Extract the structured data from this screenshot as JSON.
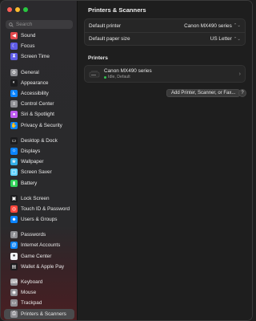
{
  "window": {
    "title": "Printers & Scanners"
  },
  "search": {
    "placeholder": "Search"
  },
  "sidebar": {
    "groups": [
      [
        {
          "label": "Sound",
          "icon": "speaker-icon",
          "color": "#e5484d"
        },
        {
          "label": "Focus",
          "icon": "moon-icon",
          "color": "#5e5ce6"
        },
        {
          "label": "Screen Time",
          "icon": "hourglass-icon",
          "color": "#5e5ce6"
        }
      ],
      [
        {
          "label": "General",
          "icon": "gear-icon",
          "color": "#8e8e93"
        },
        {
          "label": "Appearance",
          "icon": "appearance-icon",
          "color": "#1c1c1e"
        },
        {
          "label": "Accessibility",
          "icon": "accessibility-icon",
          "color": "#0a84ff"
        },
        {
          "label": "Control Center",
          "icon": "control-center-icon",
          "color": "#8e8e93"
        },
        {
          "label": "Siri & Spotlight",
          "icon": "siri-icon",
          "color": "#bf5af2"
        },
        {
          "label": "Privacy & Security",
          "icon": "hand-icon",
          "color": "#0a84ff"
        }
      ],
      [
        {
          "label": "Desktop & Dock",
          "icon": "dock-icon",
          "color": "#1c1c1e"
        },
        {
          "label": "Displays",
          "icon": "display-icon",
          "color": "#0a84ff"
        },
        {
          "label": "Wallpaper",
          "icon": "wallpaper-icon",
          "color": "#32ade6"
        },
        {
          "label": "Screen Saver",
          "icon": "screensaver-icon",
          "color": "#64d2ff"
        },
        {
          "label": "Battery",
          "icon": "battery-icon",
          "color": "#30d158"
        }
      ],
      [
        {
          "label": "Lock Screen",
          "icon": "lock-icon",
          "color": "#1c1c1e"
        },
        {
          "label": "Touch ID & Password",
          "icon": "fingerprint-icon",
          "color": "#ff453a"
        },
        {
          "label": "Users & Groups",
          "icon": "users-icon",
          "color": "#0a84ff"
        }
      ],
      [
        {
          "label": "Passwords",
          "icon": "key-icon",
          "color": "#8e8e93"
        },
        {
          "label": "Internet Accounts",
          "icon": "at-icon",
          "color": "#0a84ff"
        },
        {
          "label": "Game Center",
          "icon": "game-center-icon",
          "color": "#f2f2f7"
        },
        {
          "label": "Wallet & Apple Pay",
          "icon": "wallet-icon",
          "color": "#1c1c1e"
        }
      ],
      [
        {
          "label": "Keyboard",
          "icon": "keyboard-icon",
          "color": "#8e8e93"
        },
        {
          "label": "Mouse",
          "icon": "mouse-icon",
          "color": "#8e8e93"
        },
        {
          "label": "Trackpad",
          "icon": "trackpad-icon",
          "color": "#8e8e93"
        },
        {
          "label": "Printers & Scanners",
          "icon": "printer-icon",
          "color": "#8e8e93",
          "selected": true
        }
      ]
    ]
  },
  "defaults": {
    "default_printer_label": "Default printer",
    "default_printer_value": "Canon MX490 series",
    "paper_size_label": "Default paper size",
    "paper_size_value": "US Letter"
  },
  "printers": {
    "section_title": "Printers",
    "items": [
      {
        "name": "Canon MX490 series",
        "status": "Idle, Default",
        "status_color": "#31c24f"
      }
    ],
    "add_button": "Add Printer, Scanner, or Fax...",
    "help": "?"
  }
}
